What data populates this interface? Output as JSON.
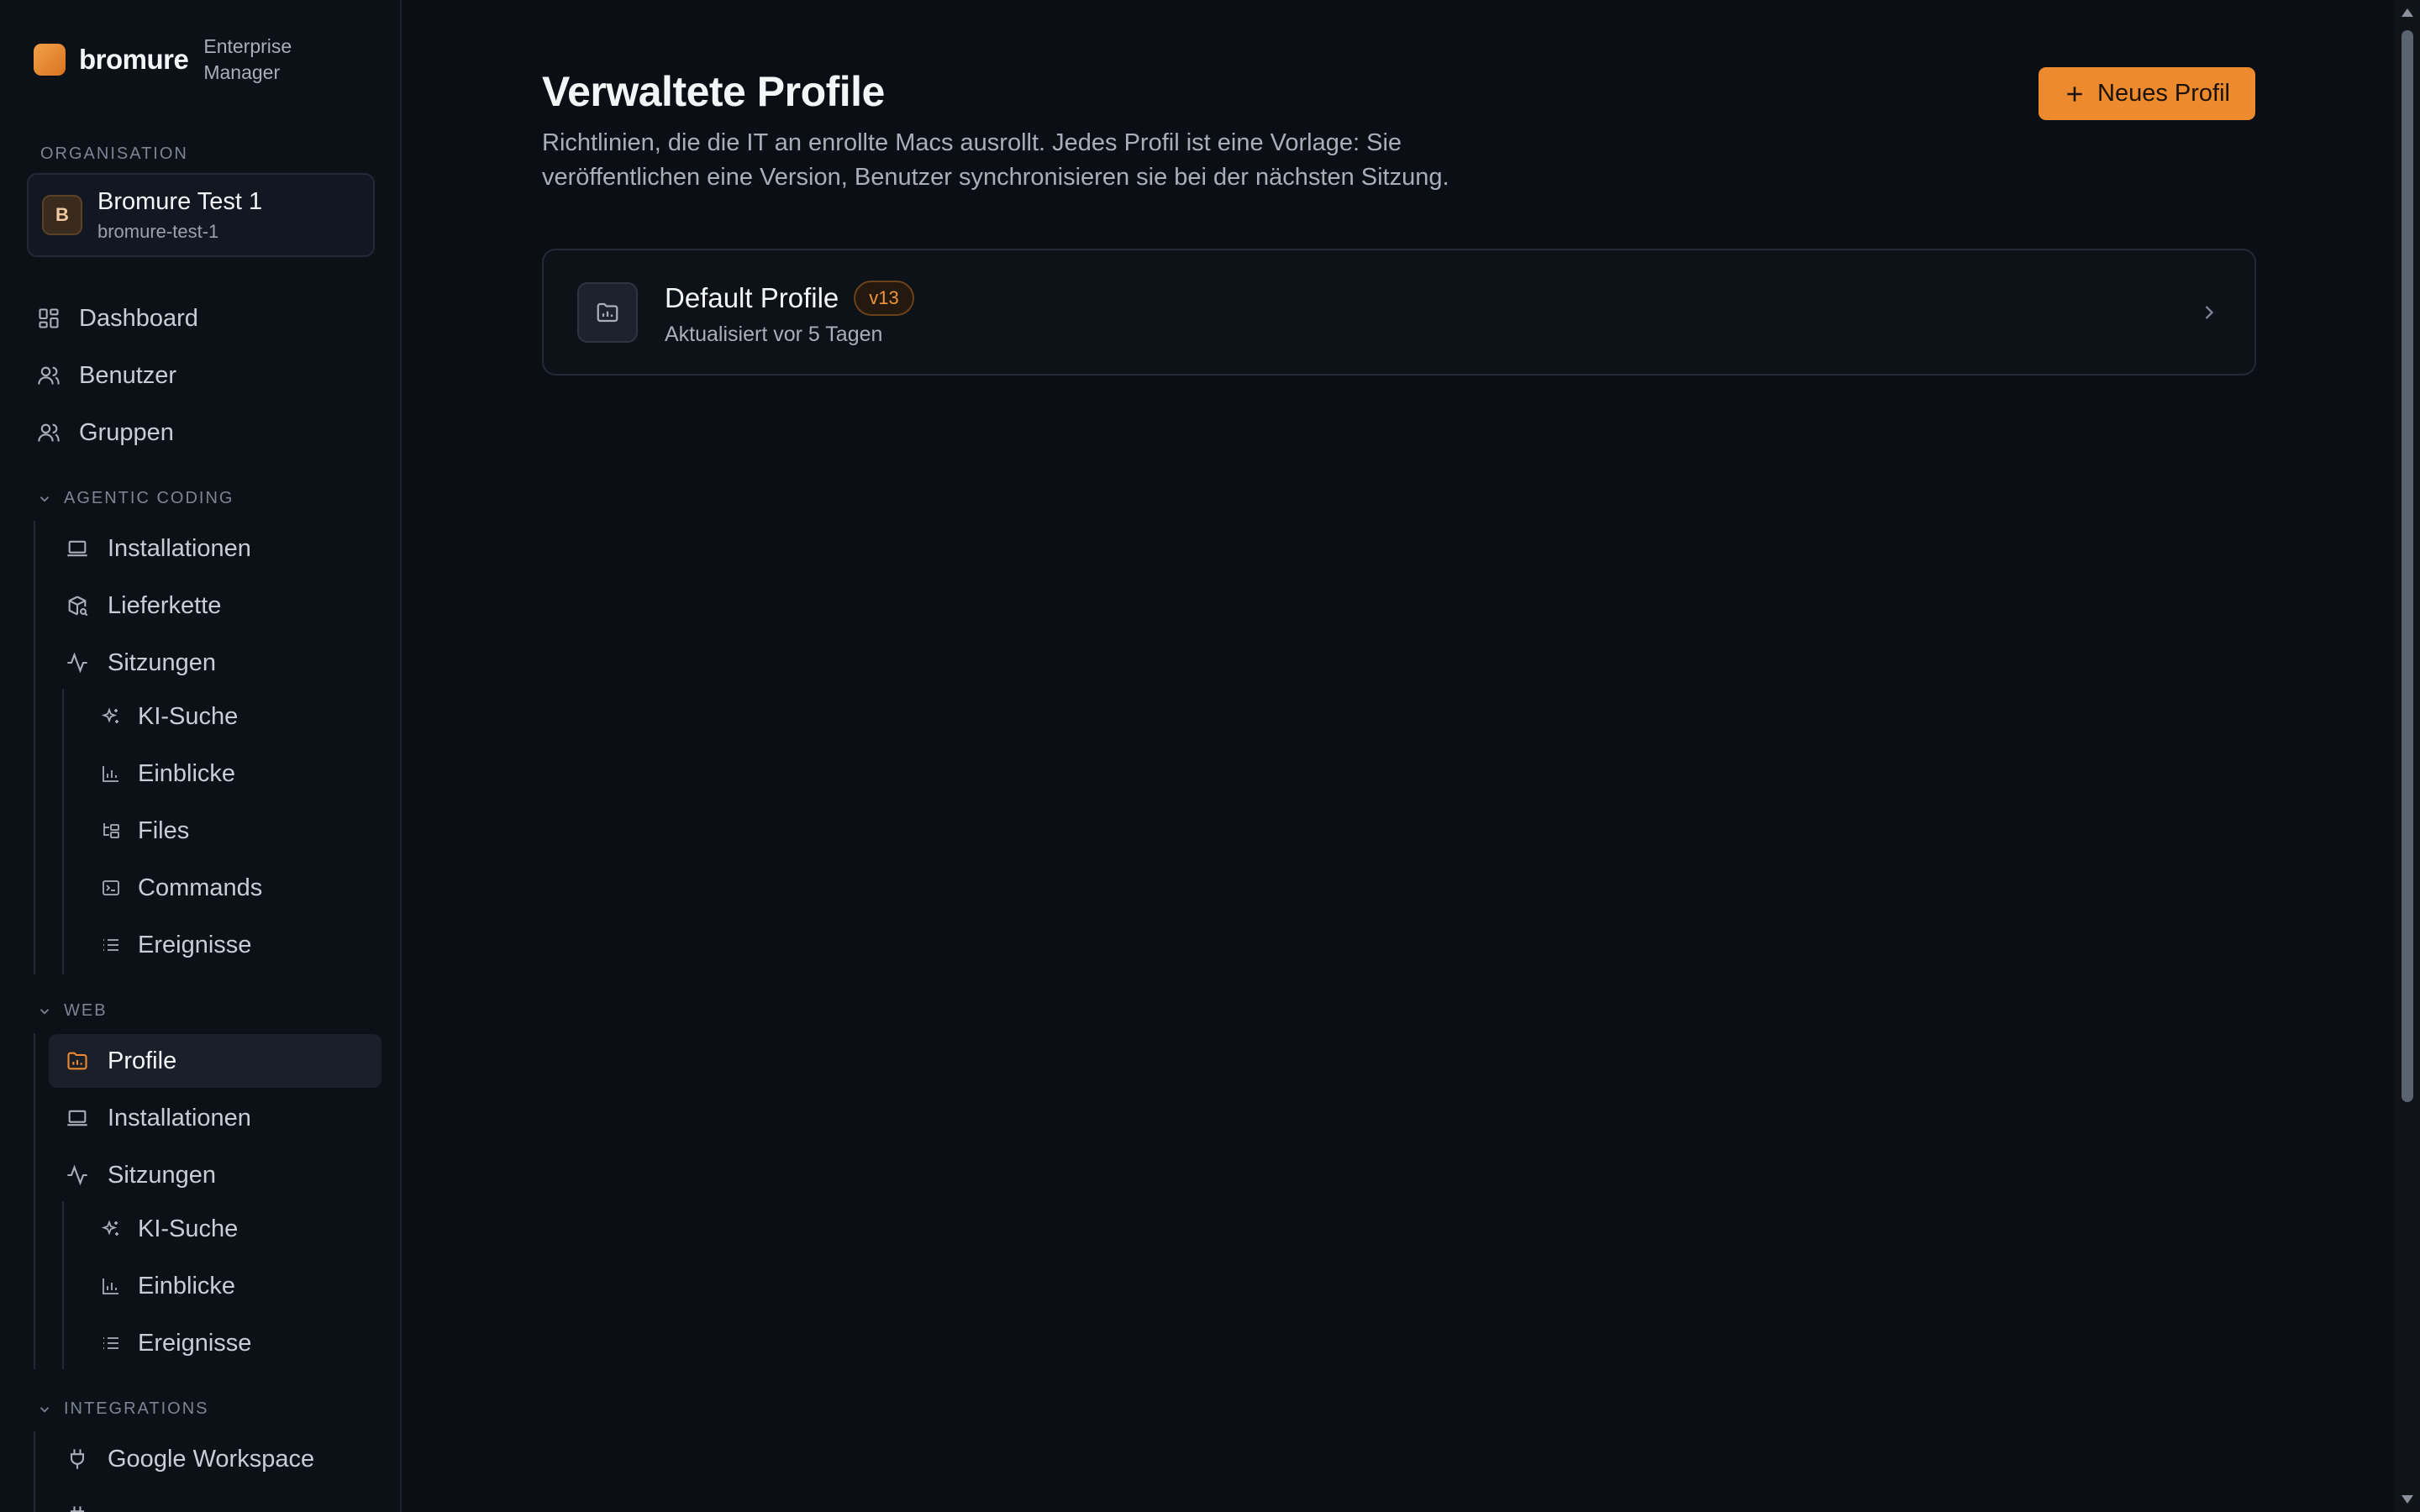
{
  "brand": {
    "name": "bromure",
    "subtitle": "Enterprise Manager"
  },
  "organisation": {
    "section_label": "ORGANISATION",
    "initial": "B",
    "name": "Bromure Test 1",
    "slug": "bromure-test-1"
  },
  "nav": {
    "dashboard": "Dashboard",
    "users": "Benutzer",
    "groups": "Gruppen"
  },
  "agentic_coding": {
    "label": "AGENTIC CODING",
    "installations": "Installationen",
    "supply_chain": "Lieferkette",
    "sessions": "Sitzungen",
    "ai_search": "KI-Suche",
    "insights": "Einblicke",
    "files": "Files",
    "commands": "Commands",
    "events": "Ereignisse"
  },
  "web": {
    "label": "WEB",
    "profile": "Profile",
    "installations": "Installationen",
    "sessions": "Sitzungen",
    "ai_search": "KI-Suche",
    "insights": "Einblicke",
    "events": "Ereignisse"
  },
  "integrations": {
    "label": "INTEGRATIONS",
    "google": "Google Workspace"
  },
  "page": {
    "title": "Verwaltete Profile",
    "description": "Richtlinien, die die IT an enrollte Macs ausrollt. Jedes Profil ist eine Vorlage: Sie veröffentlichen eine Version, Benutzer synchronisieren sie bei der nächsten Sitzung.",
    "new_button": "Neues Profil"
  },
  "profiles": [
    {
      "name": "Default Profile",
      "version": "v13",
      "updated": "Aktualisiert vor 5 Tagen"
    }
  ],
  "colors": {
    "accent": "#ee8a2e",
    "background": "#0b0e14",
    "sidebar": "#0c1017"
  }
}
